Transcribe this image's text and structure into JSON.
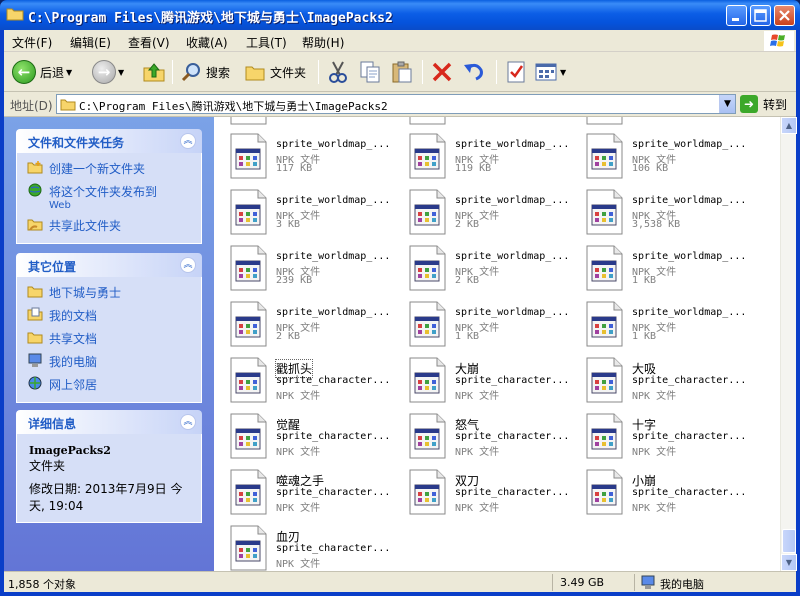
{
  "window": {
    "title": "C:\\Program Files\\腾讯游戏\\地下城与勇士\\ImagePacks2"
  },
  "menu": [
    "文件(F)",
    "编辑(E)",
    "查看(V)",
    "收藏(A)",
    "工具(T)",
    "帮助(H)"
  ],
  "toolbar": {
    "back_label": "后退",
    "search_label": "搜索",
    "folders_label": "文件夹"
  },
  "address": {
    "label": "地址(D)",
    "value": "C:\\Program Files\\腾讯游戏\\地下城与勇士\\ImagePacks2",
    "go_label": "转到"
  },
  "tasks_panel": {
    "title": "文件和文件夹任务",
    "items": [
      {
        "label": "创建一个新文件夹",
        "icon": "new-folder-icon"
      },
      {
        "label": "将这个文件夹发布到",
        "sub": "Web",
        "icon": "publish-web-icon"
      },
      {
        "label": "共享此文件夹",
        "icon": "share-folder-icon"
      }
    ]
  },
  "places_panel": {
    "title": "其它位置",
    "items": [
      {
        "label": "地下城与勇士",
        "icon": "folder-icon"
      },
      {
        "label": "我的文档",
        "icon": "my-documents-icon"
      },
      {
        "label": "共享文档",
        "icon": "shared-documents-icon"
      },
      {
        "label": "我的电脑",
        "icon": "my-computer-icon"
      },
      {
        "label": "网上邻居",
        "icon": "network-places-icon"
      }
    ]
  },
  "details_panel": {
    "title": "详细信息",
    "name": "ImagePacks2",
    "type": "文件夹",
    "modified": "修改日期: 2013年7月9日 今天, 19:04"
  },
  "files": [
    {
      "name": "sprite_worldmap_...",
      "type": "NPK 文件",
      "size": "117 KB"
    },
    {
      "name": "sprite_worldmap_...",
      "type": "NPK 文件",
      "size": "119 KB"
    },
    {
      "name": "sprite_worldmap_...",
      "type": "NPK 文件",
      "size": "106 KB"
    },
    {
      "name": "sprite_worldmap_...",
      "type": "NPK 文件",
      "size": "3 KB"
    },
    {
      "name": "sprite_worldmap_...",
      "type": "NPK 文件",
      "size": "2 KB"
    },
    {
      "name": "sprite_worldmap_...",
      "type": "NPK 文件",
      "size": "3,538 KB"
    },
    {
      "name": "sprite_worldmap_...",
      "type": "NPK 文件",
      "size": "239 KB"
    },
    {
      "name": "sprite_worldmap_...",
      "type": "NPK 文件",
      "size": "2 KB"
    },
    {
      "name": "sprite_worldmap_...",
      "type": "NPK 文件",
      "size": "1 KB"
    },
    {
      "name": "sprite_worldmap_...",
      "type": "NPK 文件",
      "size": "2 KB"
    },
    {
      "name": "sprite_worldmap_...",
      "type": "NPK 文件",
      "size": "1 KB"
    },
    {
      "name": "sprite_worldmap_...",
      "type": "NPK 文件",
      "size": "1 KB"
    },
    {
      "name": "戳抓头",
      "type": "sprite_character...",
      "size": "NPK 文件",
      "cn": true,
      "focused": true
    },
    {
      "name": "大崩",
      "type": "sprite_character...",
      "size": "NPK 文件",
      "cn": true
    },
    {
      "name": "大吸",
      "type": "sprite_character...",
      "size": "NPK 文件",
      "cn": true
    },
    {
      "name": "觉醒",
      "type": "sprite_character...",
      "size": "NPK 文件",
      "cn": true
    },
    {
      "name": "怒气",
      "type": "sprite_character...",
      "size": "NPK 文件",
      "cn": true
    },
    {
      "name": "十字",
      "type": "sprite_character...",
      "size": "NPK 文件",
      "cn": true
    },
    {
      "name": "噬魂之手",
      "type": "sprite_character...",
      "size": "NPK 文件",
      "cn": true
    },
    {
      "name": "双刀",
      "type": "sprite_character...",
      "size": "NPK 文件",
      "cn": true
    },
    {
      "name": "小崩",
      "type": "sprite_character...",
      "size": "NPK 文件",
      "cn": true
    },
    {
      "name": "血刃",
      "type": "sprite_character...",
      "size": "NPK 文件",
      "cn": true
    }
  ],
  "status": {
    "count": "1,858 个对象",
    "size": "3.49 GB",
    "location": "我的电脑"
  }
}
